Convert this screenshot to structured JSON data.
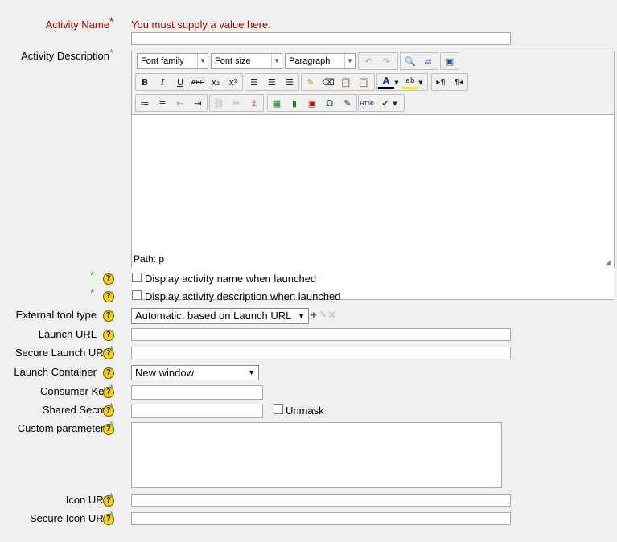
{
  "activity_name": {
    "label": "Activity Name",
    "required_marker": "*",
    "error": "You must supply a value here.",
    "value": ""
  },
  "activity_description": {
    "label": "Activity Description",
    "required_marker": "*",
    "editor": {
      "font_family": "Font family",
      "font_size": "Font size",
      "format": "Paragraph",
      "path_label": "Path: p",
      "toolbar_row1": [
        "undo-icon",
        "redo-icon",
        "find-icon",
        "replace-icon",
        "fullscreen-icon"
      ],
      "toolbar_row2": [
        "bold-icon",
        "italic-icon",
        "underline-icon",
        "strikethrough-icon",
        "subscript-icon",
        "superscript-icon",
        "align-left-icon",
        "align-center-icon",
        "align-right-icon",
        "cleanup-icon",
        "eraser-icon",
        "paste-text-icon",
        "paste-word-icon",
        "text-color-icon",
        "highlight-color-icon",
        "ltr-icon",
        "rtl-icon"
      ],
      "toolbar_row3": [
        "bullet-list-icon",
        "numbered-list-icon",
        "outdent-icon",
        "indent-icon",
        "link-icon",
        "unlink-icon",
        "anchor-icon",
        "image-icon",
        "media-icon",
        "emoticon-icon",
        "special-char-icon",
        "edit-icon",
        "html-icon",
        "spellcheck-icon"
      ]
    }
  },
  "display_name": {
    "required_marker": "*",
    "label": "Display activity name when launched",
    "checked": false
  },
  "display_description": {
    "required_marker": "*",
    "label": "Display activity description when launched",
    "checked": false
  },
  "external_tool_type": {
    "label": "External tool type",
    "value": "Automatic, based on Launch URL"
  },
  "launch_url": {
    "label": "Launch URL",
    "value": ""
  },
  "secure_launch_url": {
    "label": "Secure Launch URL",
    "required_marker": "*",
    "value": ""
  },
  "launch_container": {
    "label": "Launch Container",
    "value": "New window"
  },
  "consumer_key": {
    "label": "Consumer Key",
    "required_marker": "*",
    "value": ""
  },
  "shared_secret": {
    "label": "Shared Secret",
    "required_marker": "*",
    "value": "",
    "unmask_label": "Unmask"
  },
  "custom_parameters": {
    "label": "Custom parameters",
    "required_marker": "*",
    "value": ""
  },
  "icon_url": {
    "label": "Icon URL",
    "required_marker": "*",
    "value": ""
  },
  "secure_icon_url": {
    "label": "Secure Icon URL",
    "required_marker": "*",
    "value": ""
  },
  "help_glyph": "?",
  "colors": {
    "error": "#aa0000",
    "required": "#44aa44",
    "help": "#f5d20a"
  }
}
